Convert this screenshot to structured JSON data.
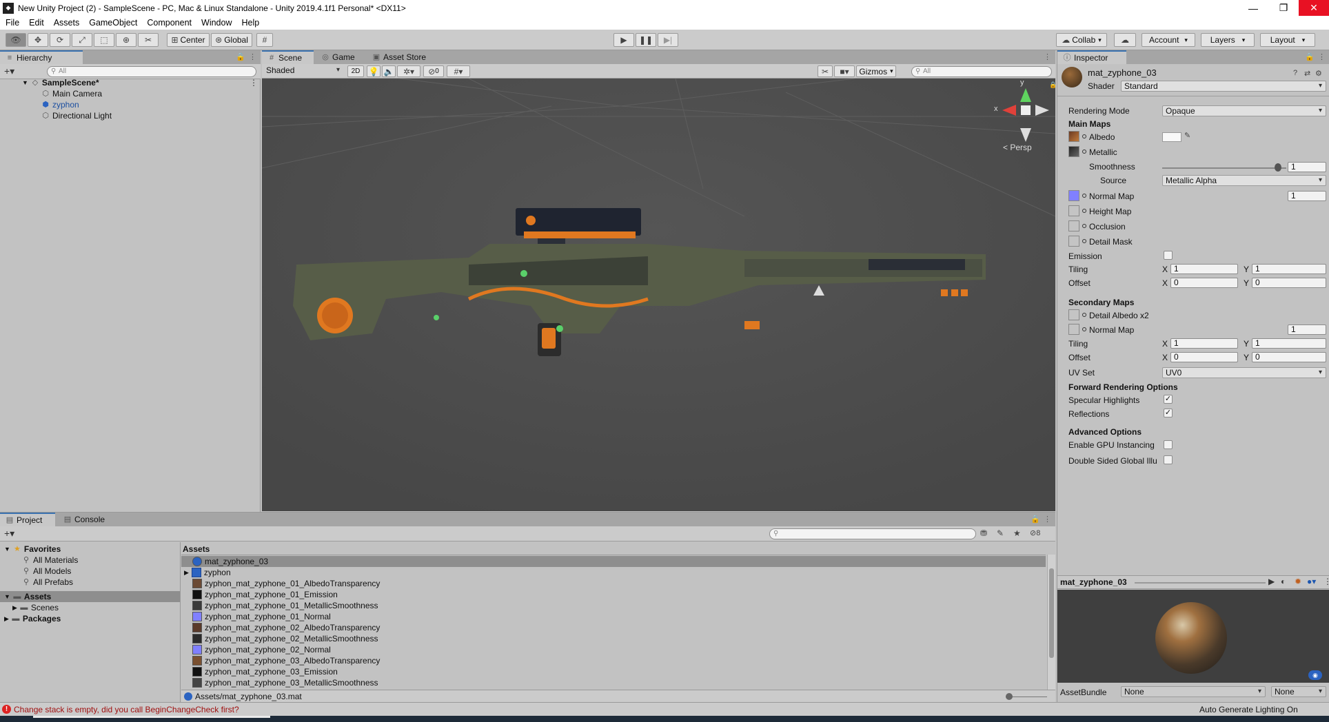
{
  "window": {
    "title": "New Unity Project (2) - SampleScene - PC, Mac & Linux Standalone - Unity 2019.4.1f1 Personal* <DX11>",
    "minimize": "—",
    "maximize": "❐",
    "close": "✕"
  },
  "menu": [
    "File",
    "Edit",
    "Assets",
    "GameObject",
    "Component",
    "Window",
    "Help"
  ],
  "toolbar": {
    "pivot_label": "Center",
    "space_label": "Global",
    "collab_label": "Collab",
    "account_label": "Account",
    "layers_label": "Layers",
    "layout_label": "Layout"
  },
  "hierarchy": {
    "tab": "Hierarchy",
    "search_placeholder": "All",
    "scene": "SampleScene*",
    "items": [
      "Main Camera",
      "zyphon",
      "Directional Light"
    ]
  },
  "scene_tabs": {
    "scene": "Scene",
    "game": "Game",
    "store": "Asset Store"
  },
  "scene_toolbar": {
    "shading": "Shaded",
    "mode2d": "2D",
    "hidden_count": "0",
    "gizmos": "Gizmos",
    "search_placeholder": "All",
    "persp": "< Persp",
    "axis_x": "x",
    "axis_y": "y"
  },
  "inspector": {
    "tab": "Inspector",
    "material_name": "mat_zyphone_03",
    "shader_label": "Shader",
    "shader_value": "Standard",
    "rendering_mode_label": "Rendering Mode",
    "rendering_mode_value": "Opaque",
    "main_maps": "Main Maps",
    "albedo": "Albedo",
    "metallic": "Metallic",
    "smoothness": "Smoothness",
    "smoothness_value": "1",
    "source": "Source",
    "source_value": "Metallic Alpha",
    "normal_map": "Normal Map",
    "normal_value": "1",
    "height_map": "Height Map",
    "occlusion": "Occlusion",
    "detail_mask": "Detail Mask",
    "emission": "Emission",
    "tiling": "Tiling",
    "offset": "Offset",
    "x": "X",
    "y": "Y",
    "tiling_x": "1",
    "tiling_y": "1",
    "offset_x": "0",
    "offset_y": "0",
    "secondary_maps": "Secondary Maps",
    "detail_albedo": "Detail Albedo x2",
    "sec_normal_map": "Normal Map",
    "sec_normal_value": "1",
    "sec_tiling_x": "1",
    "sec_tiling_y": "1",
    "sec_offset_x": "0",
    "sec_offset_y": "0",
    "uv_set": "UV Set",
    "uv_set_value": "UV0",
    "forward_options": "Forward Rendering Options",
    "specular_highlights": "Specular Highlights",
    "reflections": "Reflections",
    "advanced_options": "Advanced Options",
    "gpu_instancing": "Enable GPU Instancing",
    "double_sided": "Double Sided Global Illu",
    "checkmark": "✓",
    "preview_title": "mat_zyphone_03",
    "assetbundle_label": "AssetBundle",
    "assetbundle_value": "None",
    "assetbundle_variant": "None"
  },
  "project": {
    "tab_project": "Project",
    "tab_console": "Console",
    "favorites": "Favorites",
    "favorite_items": [
      "All Materials",
      "All Models",
      "All Prefabs"
    ],
    "assets": "Assets",
    "scenes": "Scenes",
    "packages": "Packages",
    "header": "Assets",
    "hidden_count": "8",
    "files": [
      "mat_zyphone_03",
      "zyphon",
      "zyphon_mat_zyphone_01_AlbedoTransparency",
      "zyphon_mat_zyphone_01_Emission",
      "zyphon_mat_zyphone_01_MetallicSmoothness",
      "zyphon_mat_zyphone_01_Normal",
      "zyphon_mat_zyphone_02_AlbedoTransparency",
      "zyphon_mat_zyphone_02_MetallicSmoothness",
      "zyphon_mat_zyphone_02_Normal",
      "zyphon_mat_zyphone_03_AlbedoTransparency",
      "zyphon_mat_zyphone_03_Emission",
      "zyphon_mat_zyphone_03_MetallicSmoothness"
    ],
    "path": "Assets/mat_zyphone_03.mat"
  },
  "status": {
    "error": "Change stack is empty, did you call BeginChangeCheck first?",
    "lighting": "Auto Generate Lighting On"
  }
}
